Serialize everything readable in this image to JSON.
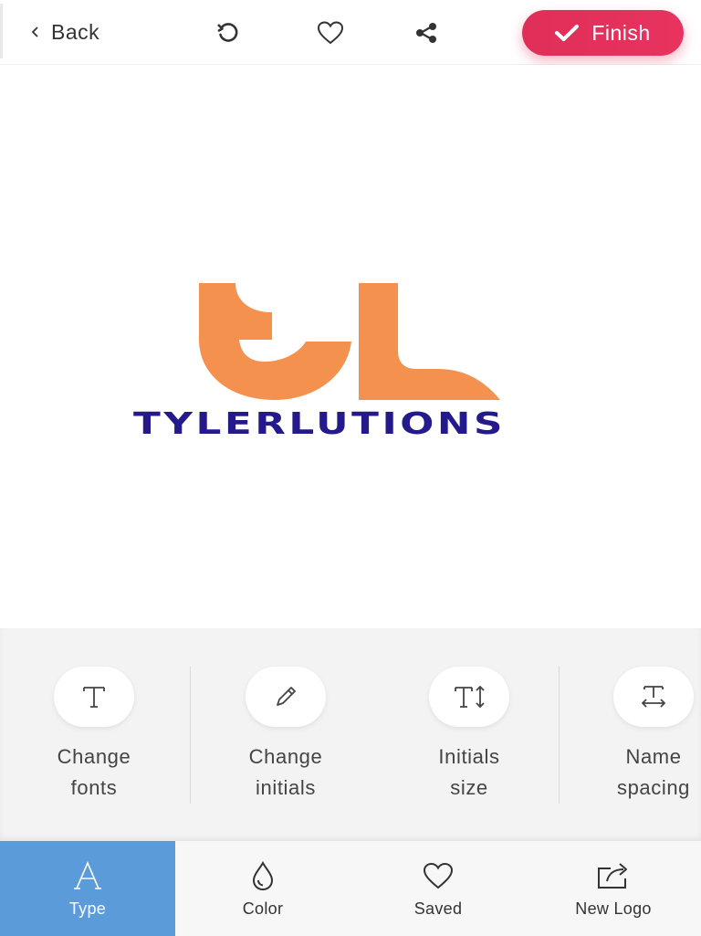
{
  "toolbar": {
    "back_label": "Back",
    "finish_label": "Finish",
    "icons": [
      "undo-icon",
      "heart-icon",
      "share-icon"
    ]
  },
  "logo": {
    "initials": "TL",
    "name": "TYLERLUTIONS",
    "initials_color": "#f4914f",
    "name_color": "#241a8c"
  },
  "tools": [
    {
      "line1": "Change",
      "line2": "fonts",
      "icon": "font-icon"
    },
    {
      "line1": "Change",
      "line2": "initials",
      "icon": "pencil-icon"
    },
    {
      "line1": "Initials",
      "line2": "size",
      "icon": "text-size-icon"
    },
    {
      "line1": "Name",
      "line2": "spacing",
      "icon": "text-spacing-icon"
    }
  ],
  "nav": [
    {
      "label": "Type",
      "icon": "type-icon",
      "active": true
    },
    {
      "label": "Color",
      "icon": "droplet-icon",
      "active": false
    },
    {
      "label": "Saved",
      "icon": "heart-icon",
      "active": false
    },
    {
      "label": "New Logo",
      "icon": "new-logo-icon",
      "active": false
    }
  ],
  "colors": {
    "accent": "#e3315b",
    "active_tab": "#5b9bd9"
  }
}
